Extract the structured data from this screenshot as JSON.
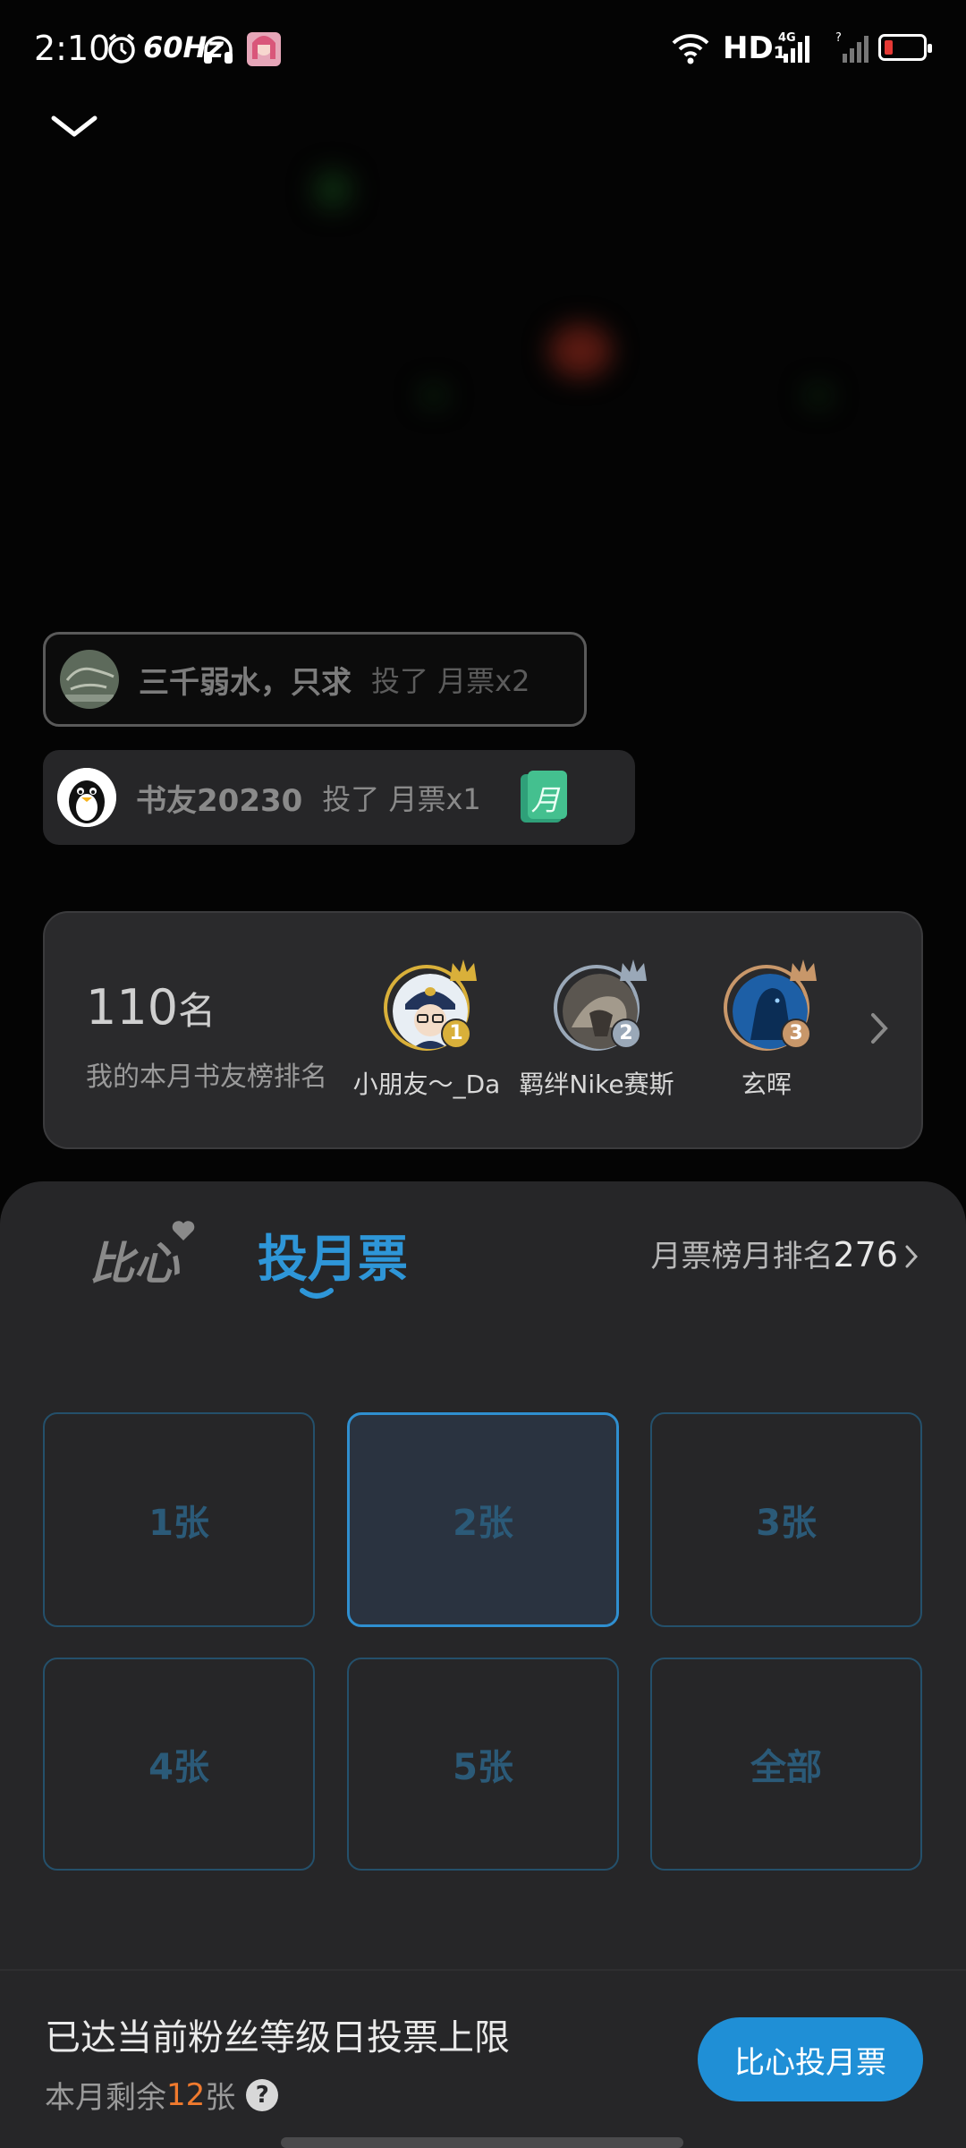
{
  "status_bar": {
    "time": "2:10",
    "refresh_rate": "60Hz",
    "network": "HD₁",
    "network_type": "4G"
  },
  "feed": [
    {
      "name": "三千弱水，只求",
      "action": "投了 月票x2",
      "avatar_icon": "sketch-avatar"
    },
    {
      "name": "书友20230",
      "action": "投了 月票x1",
      "avatar_icon": "penguin-avatar",
      "ticket_glyph": "月"
    }
  ],
  "rank_card": {
    "rank_value": "110",
    "rank_unit": "名",
    "subtitle": "我的本月书友榜排名",
    "top_fans": [
      {
        "name": "小朋友～_Da",
        "medal": "1",
        "medal_color": "#d9b03a"
      },
      {
        "name": "羁绊Nike赛斯",
        "medal": "2",
        "medal_color": "#9aa8b8"
      },
      {
        "name": "玄晖",
        "medal": "3",
        "medal_color": "#c8976a"
      }
    ]
  },
  "sheet": {
    "tab_bixin": "比心",
    "tab_vote": "投月票",
    "month_rank_label": "月票榜月排名",
    "month_rank_value": "276",
    "options": [
      "1张",
      "2张",
      "3张",
      "4张",
      "5张",
      "全部"
    ],
    "selected_option": "2张",
    "limit_text": "已达当前粉丝等级日投票上限",
    "remaining_prefix": "本月剩余",
    "remaining_count": "12",
    "remaining_suffix": "张",
    "help_glyph": "?",
    "vote_button": "比心投月票"
  },
  "colors": {
    "accent": "#1f8fd6",
    "remaining_count": "#f07a2e",
    "option_border": "#24506b"
  }
}
